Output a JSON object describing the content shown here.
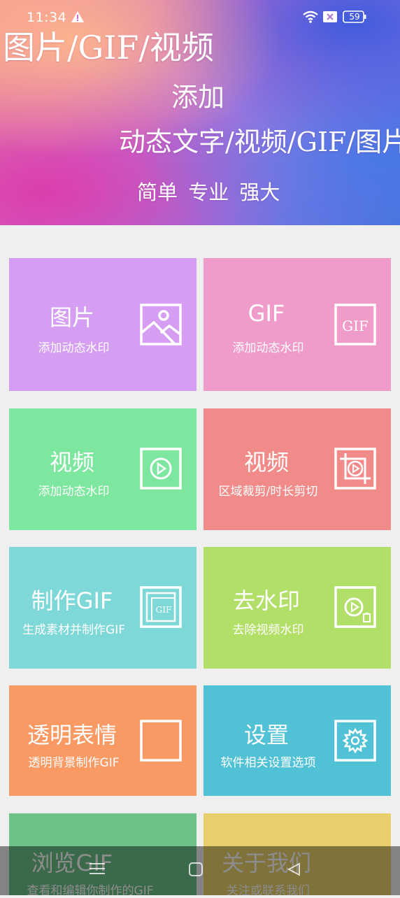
{
  "status_bar": {
    "time": "11:34",
    "battery": "59"
  },
  "banner": {
    "line1": "图片/GIF/视频",
    "line2": "添加",
    "line3": "动态文字/视频/GIF/图片",
    "line4": "简单 专业 强大"
  },
  "tiles": [
    {
      "title": "图片",
      "subtitle": "添加动态水印",
      "color": "#d59ef2",
      "icon": "image-icon"
    },
    {
      "title": "GIF",
      "subtitle": "添加动态水印",
      "color": "#f09ccb",
      "icon": "gif-icon"
    },
    {
      "title": "视频",
      "subtitle": "添加动态水印",
      "color": "#7de69f",
      "icon": "play-icon"
    },
    {
      "title": "视频",
      "subtitle": "区域裁剪/时长剪切",
      "color": "#f08b89",
      "icon": "crop-play-icon"
    },
    {
      "title": "制作GIF",
      "subtitle": "生成素材并制作GIF",
      "color": "#7fd8d8",
      "icon": "make-gif-icon"
    },
    {
      "title": "去水印",
      "subtitle": "去除视频水印",
      "color": "#b2df68",
      "icon": "remove-watermark-icon"
    },
    {
      "title": "透明表情",
      "subtitle": "透明背景制作GIF",
      "color": "#f99a64",
      "icon": "square-icon"
    },
    {
      "title": "设置",
      "subtitle": "软件相关设置选项",
      "color": "#51c2d6",
      "icon": "gear-icon"
    },
    {
      "title": "浏览GIF",
      "subtitle": "查看和编辑你制作的GIF",
      "color": "#6cc289",
      "icon": "browse-icon"
    },
    {
      "title": "关于我们",
      "subtitle": "关注或联系我们",
      "color": "#e8cf6c",
      "icon": "info-icon"
    }
  ]
}
